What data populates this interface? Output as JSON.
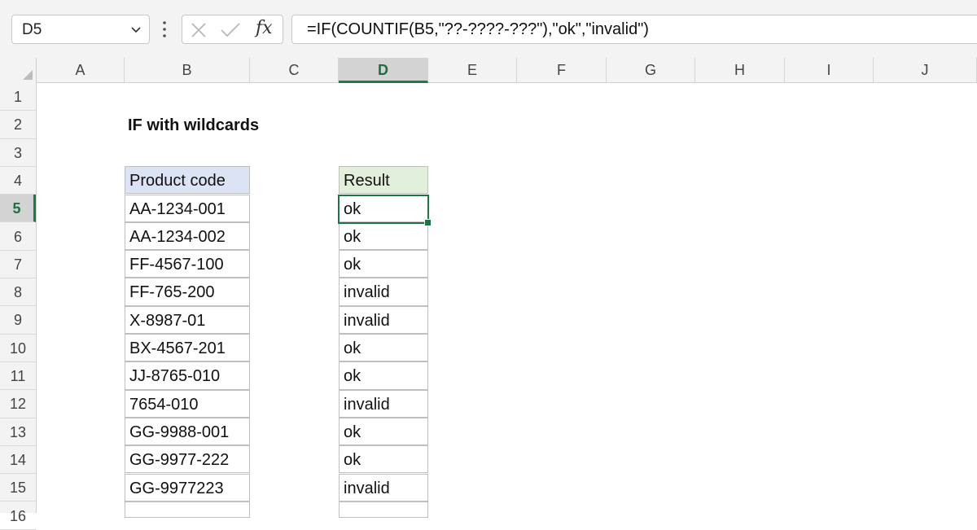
{
  "name_box": {
    "value": "D5"
  },
  "formula_bar": {
    "fx_label": "fx",
    "formula": "=IF(COUNTIF(B5,\"??-????-???\"),\"ok\",\"invalid\")"
  },
  "column_headers": [
    "A",
    "B",
    "C",
    "D",
    "E",
    "F",
    "G",
    "H",
    "I",
    "J"
  ],
  "selected_column": "D",
  "row_headers": [
    "1",
    "2",
    "3",
    "4",
    "5",
    "6",
    "7",
    "8",
    "9",
    "10",
    "11",
    "12",
    "13",
    "14",
    "15",
    "16"
  ],
  "selected_row": "5",
  "sheet": {
    "title": "IF with wildcards",
    "table": {
      "header_b": "Product code",
      "header_d": "Result",
      "rows": [
        {
          "code": "AA-1234-001",
          "result": "ok"
        },
        {
          "code": "AA-1234-002",
          "result": "ok"
        },
        {
          "code": "FF-4567-100",
          "result": "ok"
        },
        {
          "code": "FF-765-200",
          "result": "invalid"
        },
        {
          "code": "X-8987-01",
          "result": "invalid"
        },
        {
          "code": "BX-4567-201",
          "result": "ok"
        },
        {
          "code": "JJ-8765-010",
          "result": "ok"
        },
        {
          "code": "7654-010",
          "result": "invalid"
        },
        {
          "code": "GG-9988-001",
          "result": "ok"
        },
        {
          "code": "GG-9977-222",
          "result": "ok"
        },
        {
          "code": "GG-9977223",
          "result": "invalid"
        }
      ]
    }
  },
  "colors": {
    "accent": "#217346",
    "header_b_fill": "#dce3f5",
    "header_d_fill": "#e2efda"
  }
}
